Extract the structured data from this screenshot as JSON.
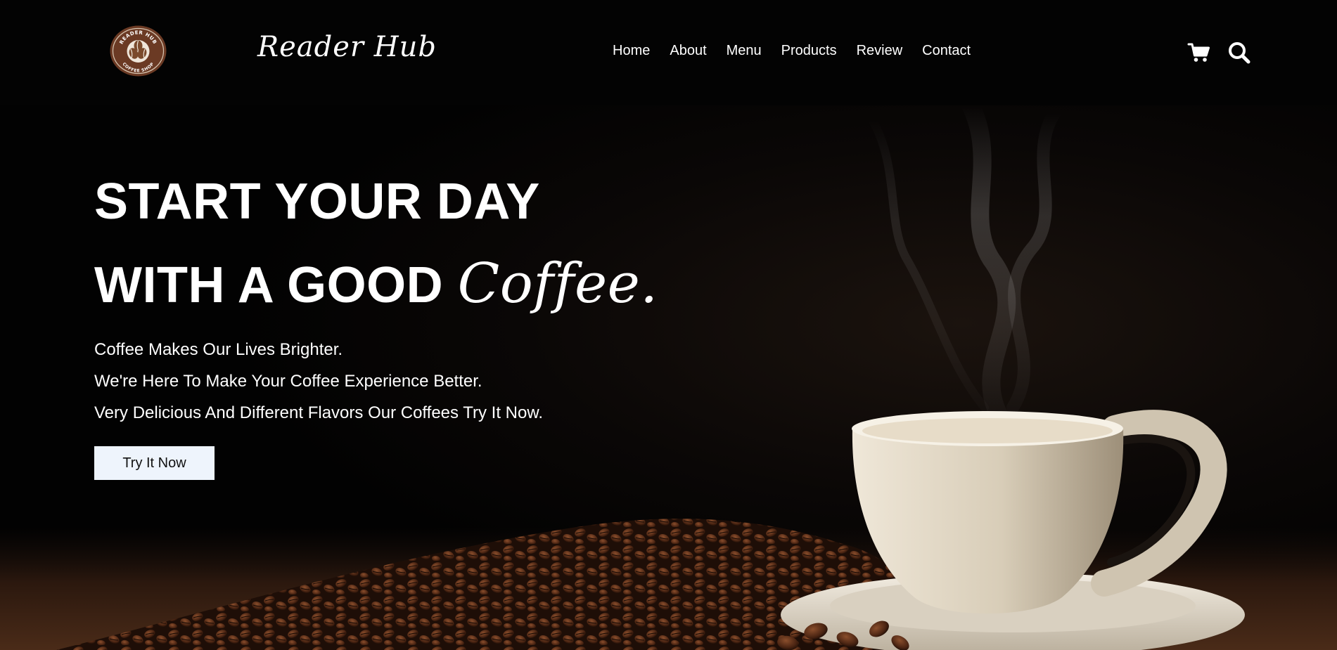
{
  "brand": {
    "name": "Reader Hub",
    "logo_text_top": "READER HUB",
    "logo_text_bottom": "COFFEE SHOP"
  },
  "nav": {
    "items": [
      "Home",
      "About",
      "Menu",
      "Products",
      "Review",
      "Contact"
    ]
  },
  "header_icons": {
    "cart": "cart-icon",
    "search": "search-icon"
  },
  "hero": {
    "headline_line1": "START YOUR DAY",
    "headline_line2_prefix": "WITH A GOOD ",
    "headline_line2_accent": "Coffee.",
    "taglines": [
      "Coffee Makes Our Lives Brighter.",
      "We're Here To Make Your Coffee Experience Better.",
      "Very Delicious And Different Flavors Our Coffees Try It Now."
    ],
    "cta_label": "Try It Now"
  },
  "colors": {
    "background": "#030303",
    "text": "#ffffff",
    "cta_background": "#eef4fc",
    "logo_brown": "#6b3a24",
    "cup": "#ddd3c0"
  }
}
